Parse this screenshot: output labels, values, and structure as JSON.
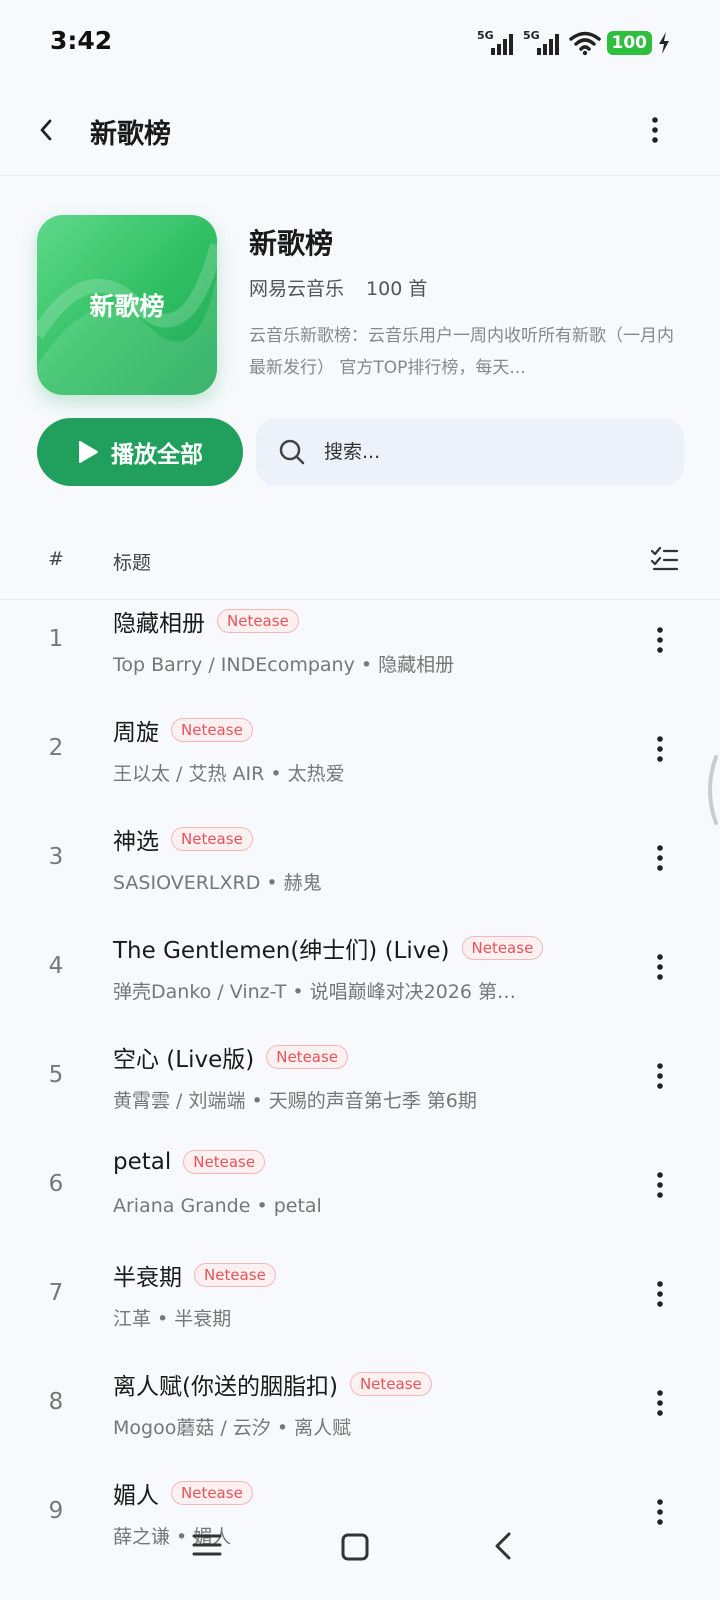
{
  "status_bar": {
    "time": "3:42",
    "signal1": "5G",
    "signal2": "5G",
    "battery": "100"
  },
  "header": {
    "title": "新歌榜"
  },
  "playlist": {
    "cover_text": "新歌榜",
    "title": "新歌榜",
    "source": "网易云音乐",
    "count": "100 首",
    "description": "云音乐新歌榜：云音乐用户一周内收听所有新歌（一月内最新发行） 官方TOP排行榜，每天..."
  },
  "actions": {
    "play_all": "播放全部",
    "search_placeholder": "搜索..."
  },
  "columns": {
    "num": "#",
    "title": "标题"
  },
  "songs": [
    {
      "index": "1",
      "title": "隐藏相册",
      "tag": "Netease",
      "subtitle": "Top Barry / INDEcompany  •  隐藏相册"
    },
    {
      "index": "2",
      "title": "周旋",
      "tag": "Netease",
      "subtitle": "王以太 / 艾热 AIR  •  太热爱"
    },
    {
      "index": "3",
      "title": "神选",
      "tag": "Netease",
      "subtitle": "SASIOVERLXRD  •  赫鬼"
    },
    {
      "index": "4",
      "title": "The Gentlemen(绅士们) (Live)",
      "tag": "Netease",
      "subtitle": "弹壳Danko / Vinz-T  •  说唱巅峰对决2026 第…"
    },
    {
      "index": "5",
      "title": "空心 (Live版)",
      "tag": "Netease",
      "subtitle": "黄霄雲 / 刘端端  •  天赐的声音第七季 第6期"
    },
    {
      "index": "6",
      "title": "petal",
      "tag": "Netease",
      "subtitle": "Ariana Grande  •  petal"
    },
    {
      "index": "7",
      "title": "半衰期",
      "tag": "Netease",
      "subtitle": "江革  •  半衰期"
    },
    {
      "index": "8",
      "title": "离人赋(你送的胭脂扣)",
      "tag": "Netease",
      "subtitle": "Mogoo蘑菇 / 云汐  •  离人赋"
    },
    {
      "index": "9",
      "title": "媚人",
      "tag": "Netease",
      "subtitle": "薛之谦  •  媚人"
    }
  ],
  "colors": {
    "accent": "#21a05d",
    "tag_text": "#e8525a",
    "background": "#f7f9fd"
  },
  "icons": {
    "back": "chevron-left-icon",
    "more": "more-vertical-icon",
    "play": "play-icon",
    "search": "search-icon",
    "select": "checklist-icon"
  }
}
